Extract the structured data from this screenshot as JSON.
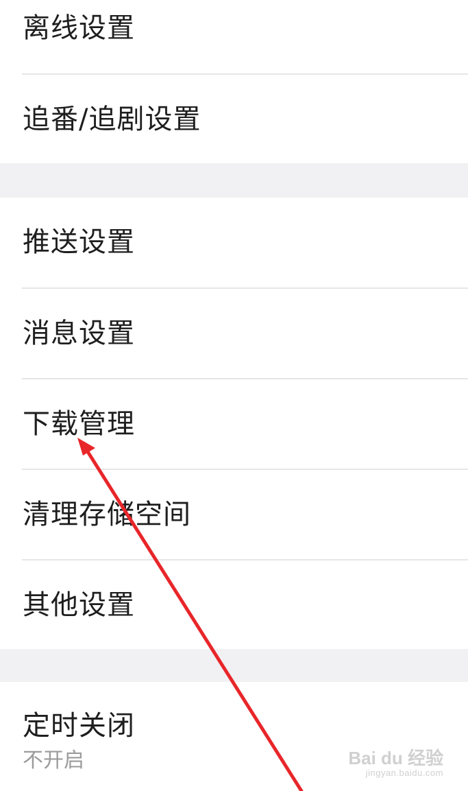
{
  "settings": {
    "group1": [
      {
        "label": "离线设置"
      },
      {
        "label": "追番/追剧设置"
      }
    ],
    "group2": [
      {
        "label": "推送设置"
      },
      {
        "label": "消息设置"
      },
      {
        "label": "下载管理"
      },
      {
        "label": "清理存储空间"
      },
      {
        "label": "其他设置"
      }
    ],
    "group3": [
      {
        "label": "定时关闭",
        "value": "不开启"
      }
    ]
  },
  "watermark": {
    "brand": "Bai du 经验",
    "url": "jingyan.baidu.com"
  },
  "annotation": {
    "arrow_color": "#e8262a",
    "points_to": "下载管理"
  }
}
